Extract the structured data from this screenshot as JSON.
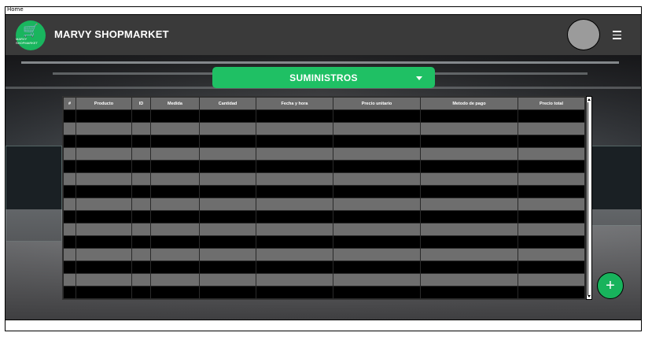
{
  "window": {
    "tab_label": "Home"
  },
  "header": {
    "brand": "MARVY SHOPMARKET",
    "logo_text": "MARVY SHOPMARKET",
    "logo_icon": "cart-icon",
    "menu_icon": "hamburger-menu-icon"
  },
  "section_selector": {
    "label": "SUMINISTROS",
    "icon": "chevron-down-icon"
  },
  "table": {
    "columns": [
      "#",
      "Producto",
      "ID",
      "Medida",
      "Cantidad",
      "Fecha y hora",
      "Precio unitario",
      "Metodo de pago",
      "Precio total"
    ],
    "rows": [
      [
        "",
        "",
        "",
        "",
        "",
        "",
        "",
        "",
        ""
      ],
      [
        "",
        "",
        "",
        "",
        "",
        "",
        "",
        "",
        ""
      ],
      [
        "",
        "",
        "",
        "",
        "",
        "",
        "",
        "",
        ""
      ],
      [
        "",
        "",
        "",
        "",
        "",
        "",
        "",
        "",
        ""
      ],
      [
        "",
        "",
        "",
        "",
        "",
        "",
        "",
        "",
        ""
      ],
      [
        "",
        "",
        "",
        "",
        "",
        "",
        "",
        "",
        ""
      ],
      [
        "",
        "",
        "",
        "",
        "",
        "",
        "",
        "",
        ""
      ],
      [
        "",
        "",
        "",
        "",
        "",
        "",
        "",
        "",
        ""
      ]
    ]
  },
  "fab": {
    "label": "+",
    "icon": "add-icon"
  },
  "colors": {
    "accent": "#1fc064",
    "header_bg": "#3a3a3a",
    "table_row": "#6e6e6e"
  }
}
